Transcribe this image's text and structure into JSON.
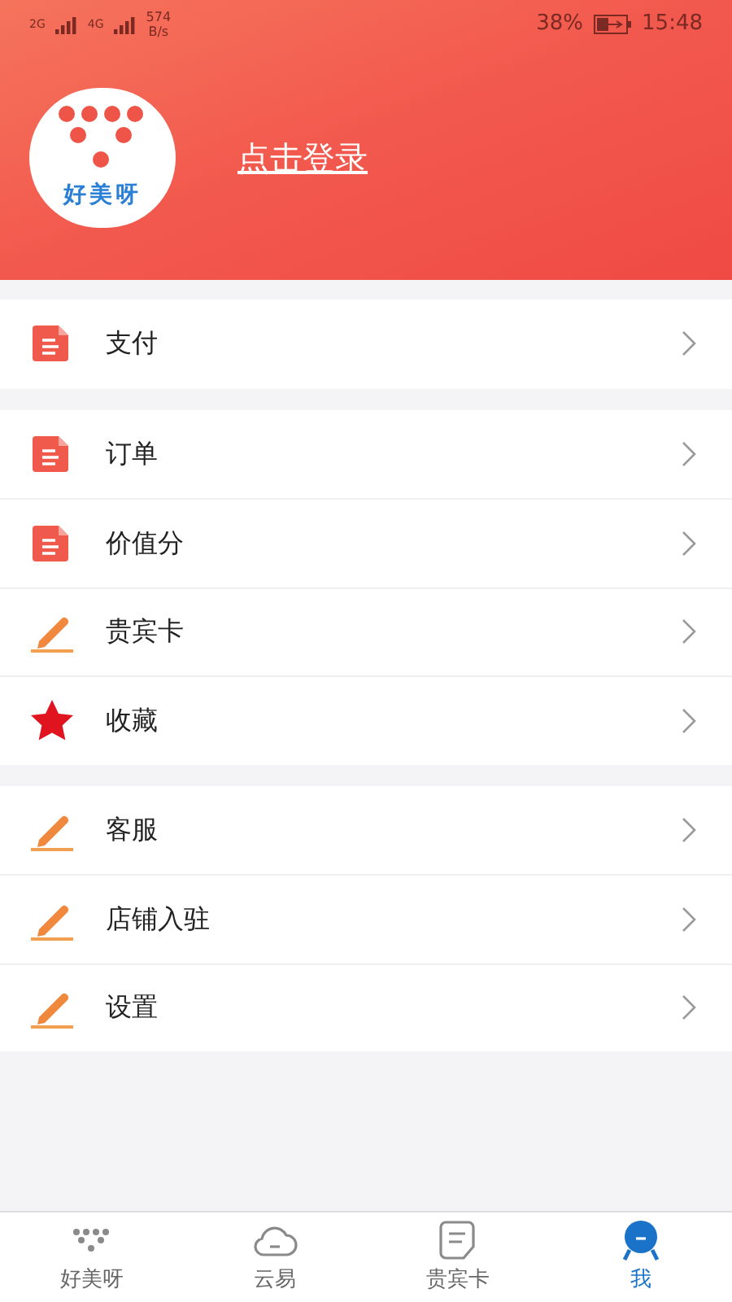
{
  "status_bar": {
    "sim_1": "2G",
    "sim_2": "4G",
    "speed_value": "574",
    "speed_unit": "B/s",
    "battery": "38%",
    "time": "15:48"
  },
  "header": {
    "logo_text": "好美呀",
    "login_link": "点击登录"
  },
  "menu_groups": [
    {
      "items": [
        {
          "kind": "document",
          "label": "支付"
        }
      ]
    },
    {
      "items": [
        {
          "kind": "document",
          "label": "订单"
        },
        {
          "kind": "document",
          "label": "价值分"
        },
        {
          "kind": "pencil",
          "label": "贵宾卡"
        },
        {
          "kind": "star",
          "label": "收藏"
        }
      ]
    },
    {
      "items": [
        {
          "kind": "pencil",
          "label": "客服"
        },
        {
          "kind": "pencil",
          "label": "店铺入驻"
        },
        {
          "kind": "pencil",
          "label": "设置"
        }
      ]
    }
  ],
  "tab_bar": [
    {
      "kind": "dots",
      "label": "好美呀",
      "selected": false
    },
    {
      "kind": "cloud",
      "label": "云易",
      "selected": false
    },
    {
      "kind": "note",
      "label": "贵宾卡",
      "selected": false
    },
    {
      "kind": "person",
      "label": "我",
      "selected": true
    }
  ]
}
